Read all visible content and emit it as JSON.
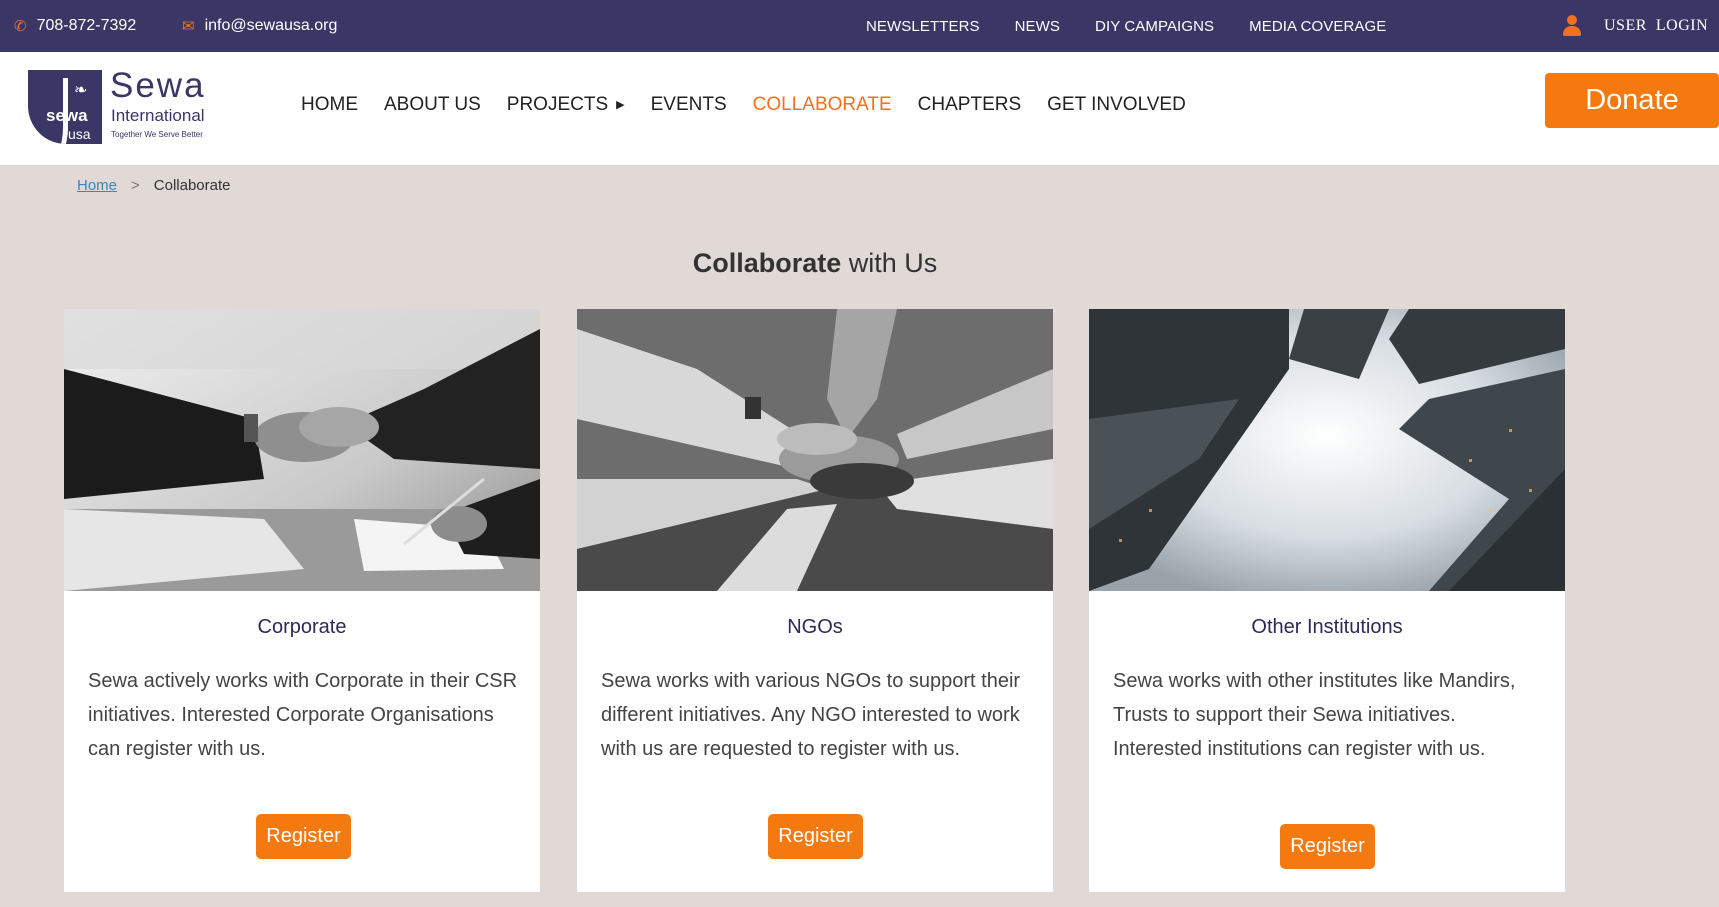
{
  "topbar": {
    "phone": "708-872-7392",
    "email": "info@sewausa.org",
    "phone_icon": "phone-icon",
    "email_icon": "envelope-icon",
    "links": [
      "NEWSLETTERS",
      "NEWS",
      "DIY CAMPAIGNS",
      "MEDIA COVERAGE"
    ],
    "user_login": "USER  LOGIN",
    "user_icon": "user-icon"
  },
  "logo": {
    "name": "Sewa",
    "name2": "International",
    "tagline": "Together We Serve Better",
    "mark_top": "sewa",
    "mark_bottom": "usa"
  },
  "nav": {
    "items": [
      "HOME",
      "ABOUT US",
      "PROJECTS",
      "EVENTS",
      "COLLABORATE",
      "CHAPTERS",
      "GET INVOLVED"
    ],
    "active": "COLLABORATE"
  },
  "donate_label": "Donate",
  "breadcrumb": {
    "home": "Home",
    "separator": ">",
    "current": "Collaborate"
  },
  "heading": {
    "bold": "Collaborate",
    "rest": " with Us"
  },
  "cards": [
    {
      "title": "Corporate",
      "description": "Sewa actively works with Corporate in their CSR initiatives. Interested Corporate Organisations can register with us.",
      "button": "Register"
    },
    {
      "title": "NGOs",
      "description": "Sewa works with various NGOs to support their different initiatives. Any NGO interested to work with us are requested to register with us.",
      "button": "Register"
    },
    {
      "title": "Other Institutions",
      "description": "Sewa works with other institutes like Mandirs, Trusts to support their Sewa initiatives. Interested institutions can register with us.",
      "button": "Register"
    }
  ],
  "colors": {
    "topbar": "#3a3767",
    "accent": "#f47a0f",
    "background": "#e0d9d6"
  }
}
